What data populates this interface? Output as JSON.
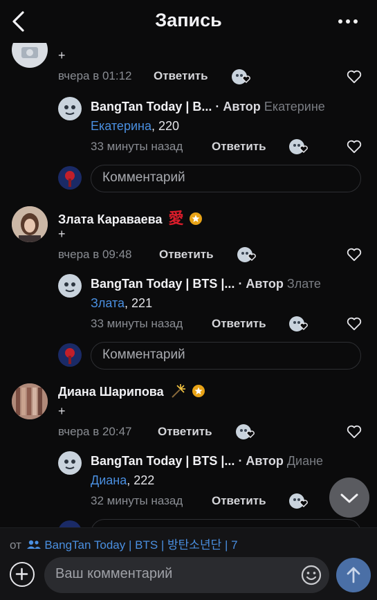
{
  "header": {
    "title": "Запись"
  },
  "comments": [
    {
      "plus": "+",
      "time": "вчера в 01:12",
      "reply_label": "Ответить",
      "sub": {
        "name": "BangTan Today | B...",
        "author_label": "· Автор",
        "addressee": "Екатерине",
        "mention": "Екатерина",
        "text_rest": ", 220",
        "time": "33 минуты назад",
        "reply_label": "Ответить"
      },
      "comment_placeholder": "Комментарий"
    },
    {
      "name": "Злата Караваева",
      "badge_glyph": "愛",
      "plus": "+",
      "time": "вчера в 09:48",
      "reply_label": "Ответить",
      "sub": {
        "name": "BangTan Today | BTS |...",
        "author_label": "· Автор",
        "addressee": "Злате",
        "mention": "Злата",
        "text_rest": ", 221",
        "time": "33 минуты назад",
        "reply_label": "Ответить"
      },
      "comment_placeholder": "Комментарий"
    },
    {
      "name": "Диана Шарипова",
      "plus": "+",
      "time": "вчера в 20:47",
      "reply_label": "Ответить",
      "sub": {
        "name": "BangTan Today | BTS |...",
        "author_label": "· Автор",
        "addressee": "Диане",
        "mention": "Диана",
        "text_rest": ", 222",
        "time": "32 минуты назад",
        "reply_label": "Ответить"
      }
    }
  ],
  "footer": {
    "from_prefix": "от",
    "group": "BangTan Today | BTS | 방탄소년단 | 7",
    "input_placeholder": "Ваш комментарий"
  },
  "colors": {
    "accent": "#4a8fe0",
    "send": "#4a6fa6",
    "background": "#0b0b0c"
  },
  "icons": [
    "back-arrow-icon",
    "more-icon",
    "heart-icon",
    "reaction-icon",
    "star-badge-icon",
    "group-icon",
    "add-icon",
    "emoji-icon",
    "send-arrow-icon",
    "chevron-down-icon"
  ]
}
